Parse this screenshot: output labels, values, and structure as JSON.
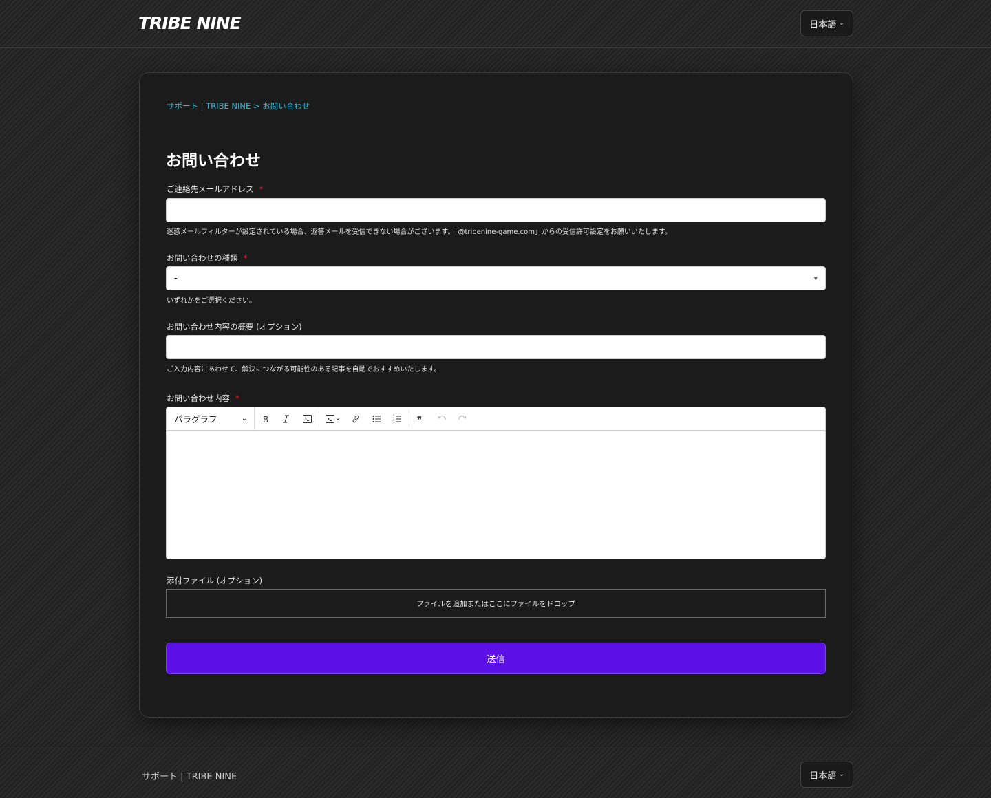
{
  "header": {
    "logo": "TRIBE NINE",
    "language": "日本語"
  },
  "breadcrumb": {
    "home": "サポート | TRIBE NINE",
    "separator": ">",
    "current": "お問い合わせ"
  },
  "form": {
    "title": "お問い合わせ",
    "required_marker": "*",
    "email": {
      "label": "ご連絡先メールアドレス",
      "value": "",
      "hint": "迷惑メールフィルターが設定されている場合、返答メールを受信できない場合がございます。「@tribenine-game.com」からの受信許可設定をお願いいたします。"
    },
    "type": {
      "label": "お問い合わせの種類",
      "selected": "-",
      "hint": "いずれかをご選択ください。"
    },
    "subject": {
      "label": "お問い合わせ内容の概要 (オプション)",
      "value": "",
      "hint": "ご入力内容にあわせて、解決につながる可能性のある記事を自動でおすすめいたします。"
    },
    "description": {
      "label": "お問い合わせ内容",
      "paragraph_style": "パラグラフ",
      "value": ""
    },
    "attachments": {
      "label": "添付ファイル (オプション)",
      "dropzone": "ファイルを追加またはここにファイルをドロップ"
    },
    "submit_label": "送信"
  },
  "footer": {
    "link": "サポート | TRIBE NINE",
    "language": "日本語"
  },
  "colors": {
    "link": "#30b8d8",
    "required": "#e0202a",
    "submit": "#5a10e6"
  }
}
